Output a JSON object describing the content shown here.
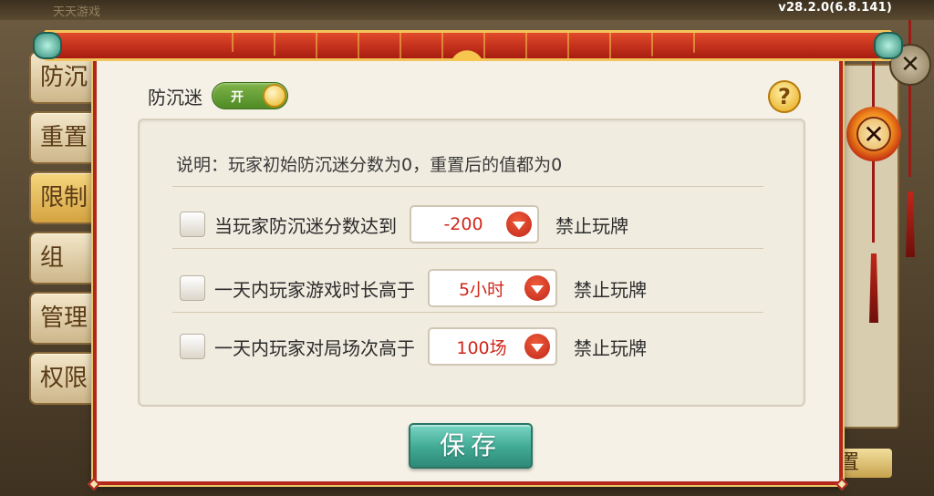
{
  "version": "v28.2.0(6.8.141)",
  "background": {
    "top_faded": "天天游戏",
    "side_tabs": [
      "防沉",
      "重置",
      "限制",
      "组",
      "管理",
      "权限"
    ],
    "reset_button": "置"
  },
  "dialog": {
    "anti_addiction": {
      "label": "防沉迷",
      "toggle_text": "开",
      "toggle_on": true
    },
    "help_label": "?",
    "description": "说明：玩家初始防沉迷分数为0，重置后的值都为0",
    "rules": [
      {
        "label": "当玩家防沉迷分数达到",
        "value": "-200",
        "suffix": "禁止玩牌",
        "checked": false
      },
      {
        "label": "一天内玩家游戏时长高于",
        "value": "5小时",
        "suffix": "禁止玩牌",
        "checked": false
      },
      {
        "label": "一天内玩家对局场次高于",
        "value": "100场",
        "suffix": "禁止玩牌",
        "checked": false
      }
    ],
    "save_label": "保存"
  },
  "icons": {
    "close_outer": "close-icon",
    "close_main": "close-icon",
    "help": "question-icon",
    "dropdown": "chevron-down-icon"
  },
  "colors": {
    "accent_red": "#d0281a",
    "save_teal": "#3fa893",
    "frame_red": "#b3271b",
    "toggle_green": "#5f9a2c"
  }
}
